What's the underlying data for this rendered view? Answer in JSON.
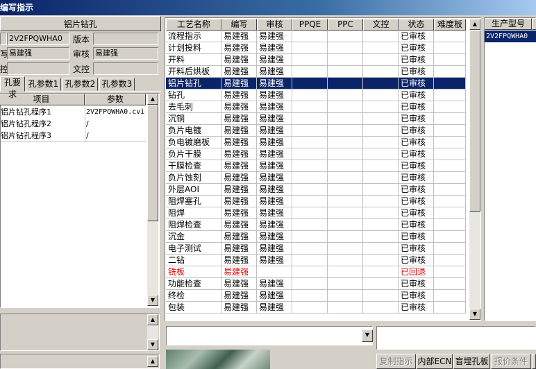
{
  "window": {
    "title": "编写指示"
  },
  "left": {
    "header": "铝片钻孔",
    "fields": {
      "code_value": "2V2FPQWHA0",
      "version_label": "版本",
      "version_value": "",
      "writer_value": "易建强",
      "review_label": "审核",
      "review_value": "易建强",
      "doc_label": "文控",
      "doc_value": "",
      "row3_value": ""
    },
    "tabs": [
      "孔要求",
      "孔参数1",
      "孔参数2",
      "孔参数3"
    ],
    "table": {
      "headers": [
        "项目",
        "参数"
      ],
      "rows": [
        [
          "铝片钻孔程序1",
          "2V2FPQWHA0.cvi"
        ],
        [
          "铝片钻孔程序2",
          "/"
        ],
        [
          "铝片钻孔程序3",
          "/"
        ]
      ]
    }
  },
  "grid": {
    "headers": [
      "工艺名称",
      "编写",
      "审核",
      "PPQE",
      "PPC",
      "文控",
      "状态",
      "难度板"
    ],
    "selected_index": 4,
    "rows": [
      [
        "流程指示",
        "易建强",
        "易建强",
        "",
        "",
        "",
        "已审核",
        ""
      ],
      [
        "计划投料",
        "易建强",
        "易建强",
        "",
        "",
        "",
        "已审核",
        ""
      ],
      [
        "开料",
        "易建强",
        "易建强",
        "",
        "",
        "",
        "已审核",
        ""
      ],
      [
        "开料后烘板",
        "易建强",
        "易建强",
        "",
        "",
        "",
        "已审核",
        ""
      ],
      [
        "铝片钻孔",
        "易建强",
        "易建强",
        "",
        "",
        "",
        "已审核",
        ""
      ],
      [
        "钻孔",
        "易建强",
        "易建强",
        "",
        "",
        "",
        "已审核",
        ""
      ],
      [
        "去毛刺",
        "易建强",
        "易建强",
        "",
        "",
        "",
        "已审核",
        ""
      ],
      [
        "沉铜",
        "易建强",
        "易建强",
        "",
        "",
        "",
        "已审核",
        ""
      ],
      [
        "负片电镀",
        "易建强",
        "易建强",
        "",
        "",
        "",
        "已审核",
        ""
      ],
      [
        "负电镀磨板",
        "易建强",
        "易建强",
        "",
        "",
        "",
        "已审核",
        ""
      ],
      [
        "负片干膜",
        "易建强",
        "易建强",
        "",
        "",
        "",
        "已审核",
        ""
      ],
      [
        "干膜检查",
        "易建强",
        "易建强",
        "",
        "",
        "",
        "已审核",
        ""
      ],
      [
        "负片蚀刻",
        "易建强",
        "易建强",
        "",
        "",
        "",
        "已审核",
        ""
      ],
      [
        "外层AOI",
        "易建强",
        "易建强",
        "",
        "",
        "",
        "已审核",
        ""
      ],
      [
        "阻焊塞孔",
        "易建强",
        "易建强",
        "",
        "",
        "",
        "已审核",
        ""
      ],
      [
        "阻焊",
        "易建强",
        "易建强",
        "",
        "",
        "",
        "已审核",
        ""
      ],
      [
        "阻焊检查",
        "易建强",
        "易建强",
        "",
        "",
        "",
        "已审核",
        ""
      ],
      [
        "沉金",
        "易建强",
        "易建强",
        "",
        "",
        "",
        "已审核",
        ""
      ],
      [
        "电子测试",
        "易建强",
        "易建强",
        "",
        "",
        "",
        "已审核",
        ""
      ],
      [
        "二钻",
        "易建强",
        "易建强",
        "",
        "",
        "",
        "已审核",
        ""
      ],
      [
        "铣板",
        "易建强",
        "",
        "",
        "",
        "",
        "已回退",
        ""
      ],
      [
        "功能检查",
        "易建强",
        "易建强",
        "",
        "",
        "",
        "已审核",
        ""
      ],
      [
        "终检",
        "易建强",
        "易建强",
        "",
        "",
        "",
        "已审核",
        ""
      ],
      [
        "包装",
        "易建强",
        "易建强",
        "",
        "",
        "",
        "已审核",
        ""
      ]
    ],
    "status_colors": {
      "normal": "#000000",
      "returned": "#e00000"
    }
  },
  "right": {
    "header": "生产型号",
    "rows": [
      "2V2FPQWHA0"
    ]
  },
  "buttons": [
    {
      "label": "复制指示",
      "enabled": false
    },
    {
      "label": "内部ECN",
      "enabled": true
    },
    {
      "label": "盲埋孔板",
      "enabled": true
    },
    {
      "label": "报价条件",
      "enabled": false
    }
  ],
  "icons": {
    "dropdown": "chevron-down-icon",
    "scroll_up": "arrow-up-icon",
    "scroll_down": "arrow-down-icon"
  }
}
